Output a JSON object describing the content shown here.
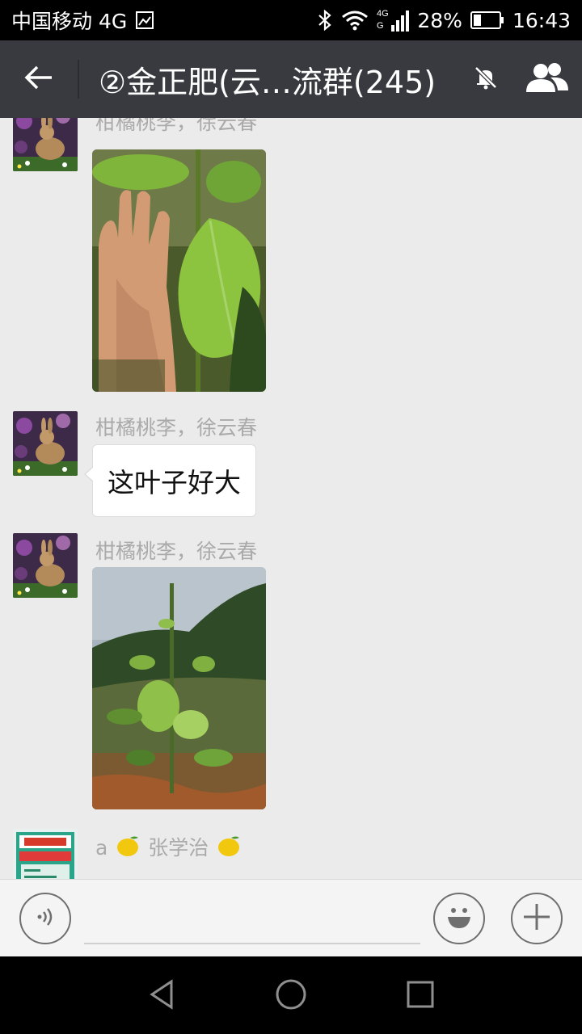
{
  "status_bar": {
    "carrier": "中国移动 4G",
    "battery_percent": "28%",
    "time": "16:43",
    "signal_label": "4G"
  },
  "header": {
    "title": "②金正肥(云…流群(245)",
    "icons": [
      "back-arrow-icon",
      "mute-bell-icon",
      "group-members-icon"
    ]
  },
  "messages": [
    {
      "sender": "柑橘桃李，徐云春",
      "type": "image",
      "image_desc_icon": "leaf-with-hand-photo"
    },
    {
      "sender": "柑橘桃李，徐云春",
      "type": "text",
      "text": "这叶子好大"
    },
    {
      "sender": "柑橘桃李，徐云春",
      "type": "image",
      "image_desc_icon": "young-tree-photo"
    },
    {
      "sender_prefix": "a",
      "sender_name": "张学治",
      "type": "text",
      "text": ""
    }
  ],
  "input_bar": {
    "icons": [
      "voice-icon",
      "emoji-icon",
      "plus-icon"
    ]
  },
  "nav_bar": {
    "icons": [
      "back-triangle-icon",
      "home-circle-icon",
      "recents-square-icon"
    ]
  },
  "colors": {
    "title_bar": "#393a3f",
    "chat_bg": "#ebebeb",
    "sender_text": "#aaaaaa"
  }
}
